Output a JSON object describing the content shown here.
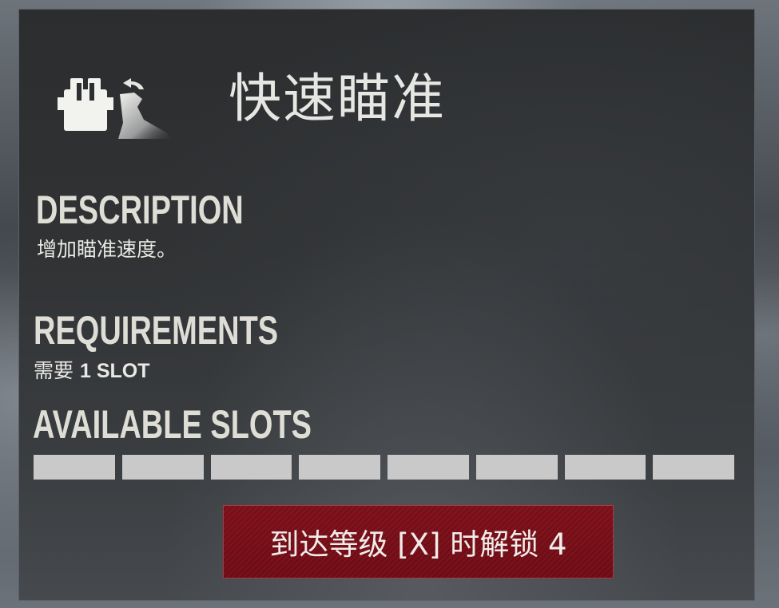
{
  "perk": {
    "title": "快速瞄准",
    "icon": "iron-sights-aim-speed-icon"
  },
  "description": {
    "heading": "DESCRIPTION",
    "text": "增加瞄准速度。"
  },
  "requirements": {
    "heading": "REQUIREMENTS",
    "prefix": "需要",
    "value": "1 SLOT"
  },
  "available_slots": {
    "heading": "AVAILABLE SLOTS",
    "total": 8,
    "filled_color": "#c9c9c9"
  },
  "unlock_button": {
    "label": "到达等级 [X] 时解锁 4"
  },
  "colors": {
    "panel_bg": "#2f3133",
    "text": "#deddd6",
    "button_bg": "#741019",
    "button_border": "#a83a44"
  }
}
